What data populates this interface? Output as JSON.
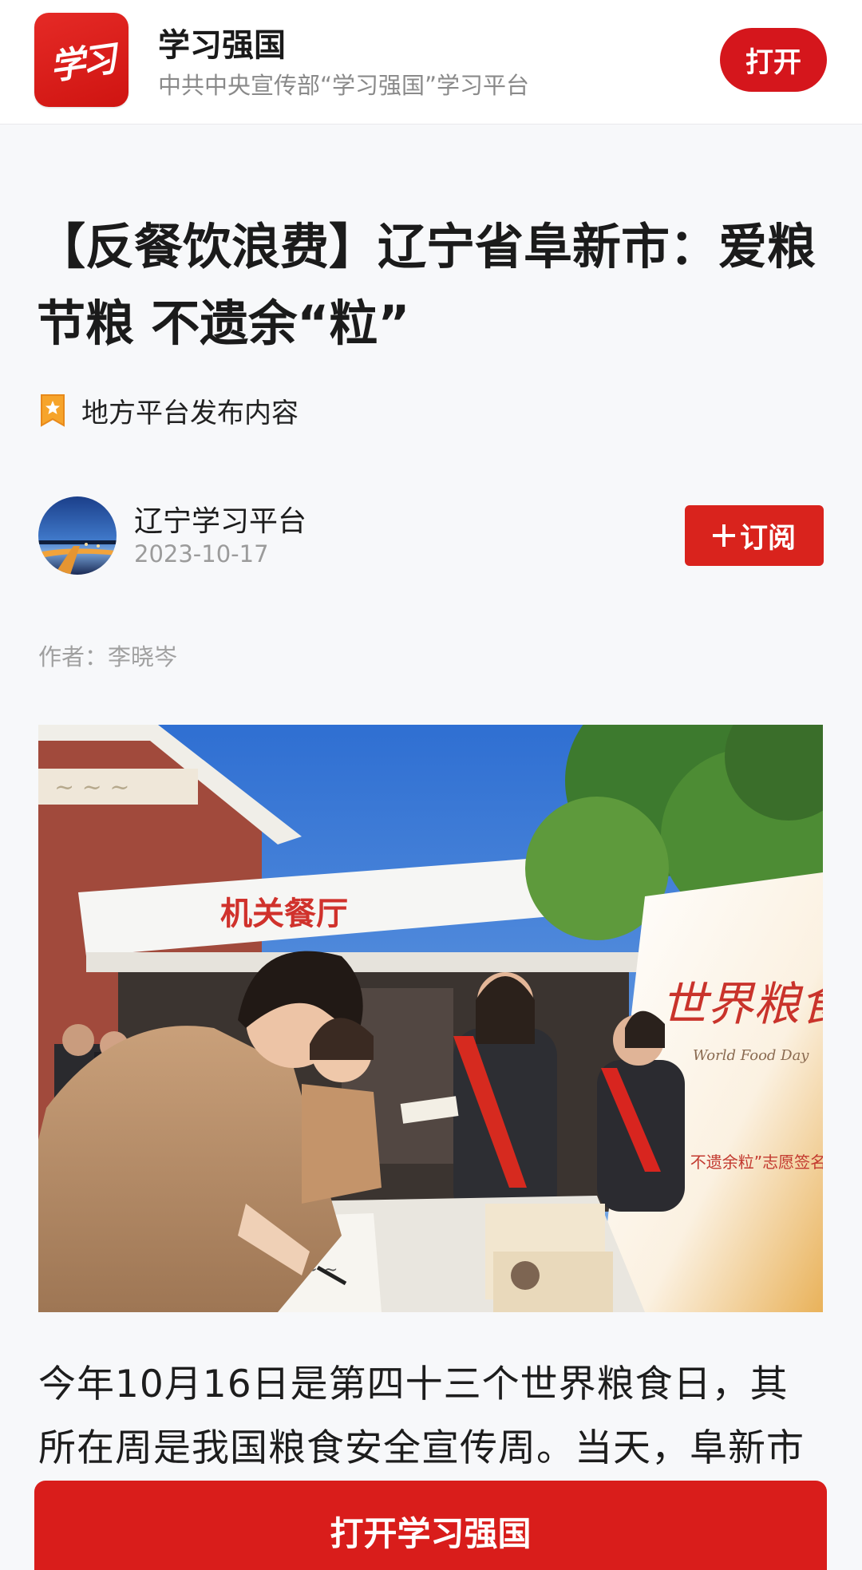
{
  "app_banner": {
    "logo_text": "学习",
    "app_name": "学习强国",
    "app_description": "中共中央宣传部“学习强国”学习平台",
    "open_label": "打开",
    "brand_color": "#d5161c"
  },
  "article": {
    "title": "【反餐饮浪费】辽宁省阜新市：爱粮节粮 不遗余“粒”",
    "source_tag": "地方平台发布内容",
    "channel": {
      "name": "辽宁学习平台",
      "date": "2023-10-17",
      "subscribe_label": "订阅"
    },
    "author_line": "作者：李晓岑",
    "photo": {
      "sign_text": "机关餐厅",
      "banner_title": "世界粮食日",
      "banner_subtitle": "World Food Day",
      "banner_slogan": "“爱粮节粮 不遗余粒”志愿签名活",
      "sash_left": "世界粮食日",
      "sash_right": "世界粮"
    },
    "body_text": "今年10月16日是第四十三个世界粮食日，其所在周是我国粮食安全宣传周。当天，阜新市"
  },
  "bottom_cta": {
    "label": "打开学习强国"
  },
  "icons": {
    "source": "star-badge-icon",
    "subscribe": "plus-icon"
  }
}
